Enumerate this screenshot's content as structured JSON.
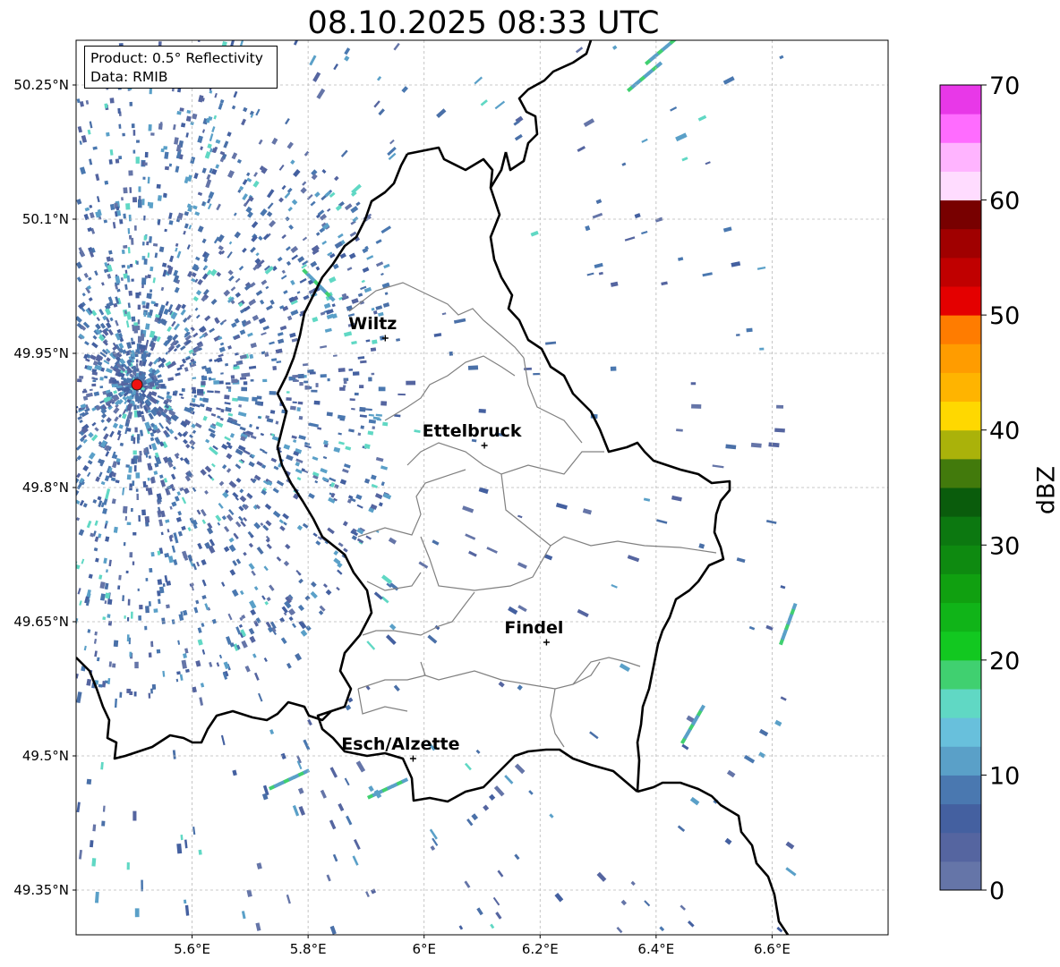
{
  "title": "08.10.2025 08:33 UTC",
  "info_box": {
    "product": "Product: 0.5° Reflectivity",
    "data_source": "Data: RMIB"
  },
  "map": {
    "lat_ticks": [
      "50.25°N",
      "50.1°N",
      "49.95°N",
      "49.8°N",
      "49.65°N",
      "49.5°N",
      "49.35°N"
    ],
    "lon_ticks": [
      "5.6°E",
      "5.8°E",
      "6°E",
      "6.2°E",
      "6.4°E",
      "6.6°E"
    ],
    "lat_range": [
      49.3,
      50.3
    ],
    "lon_range": [
      5.4,
      6.8
    ],
    "gridlines": true,
    "radar_site": {
      "lat": 49.915,
      "lon": 5.505,
      "color": "#ee1111"
    },
    "cities": [
      {
        "name": "Wiltz",
        "lat": 49.967,
        "lon": 5.933
      },
      {
        "name": "Ettelbruck",
        "lat": 49.847,
        "lon": 6.104
      },
      {
        "name": "Findel",
        "lat": 49.627,
        "lon": 6.211
      },
      {
        "name": "Esch/Alzette",
        "lat": 49.497,
        "lon": 5.981
      }
    ]
  },
  "colorbar": {
    "label": "dBZ",
    "tick_labels": [
      "0",
      "10",
      "20",
      "30",
      "40",
      "50",
      "60",
      "70"
    ],
    "range": [
      0,
      70
    ],
    "colors": [
      "#6575a8",
      "#5565a0",
      "#4460a0",
      "#4a78b0",
      "#5aa0c8",
      "#68c0dc",
      "#60d8c4",
      "#40d070",
      "#12c820",
      "#10b418",
      "#10a010",
      "#0e8a10",
      "#0c7810",
      "#0a5c0c",
      "#427a0c",
      "#aab20a",
      "#ffd800",
      "#ffb400",
      "#ff9c00",
      "#ff7c00",
      "#e40000",
      "#c00000",
      "#a00000",
      "#780000",
      "#ffdcff",
      "#ffb4ff",
      "#ff6cff",
      "#e838e8"
    ]
  }
}
